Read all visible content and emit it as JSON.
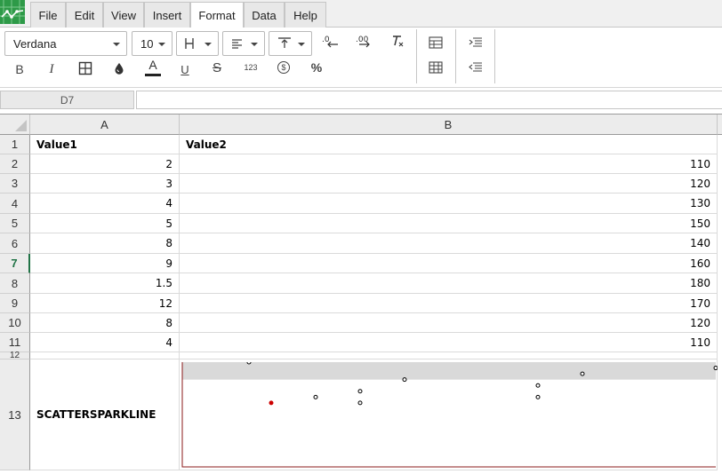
{
  "menu": {
    "items": [
      {
        "id": "file",
        "label": "File"
      },
      {
        "id": "edit",
        "label": "Edit"
      },
      {
        "id": "view",
        "label": "View"
      },
      {
        "id": "insert",
        "label": "Insert"
      },
      {
        "id": "format",
        "label": "Format",
        "active": true
      },
      {
        "id": "data",
        "label": "Data"
      },
      {
        "id": "help",
        "label": "Help"
      }
    ]
  },
  "toolbar": {
    "font_name": "Verdana",
    "font_size": "10",
    "bold_label": "B",
    "italic_label": "I",
    "font_color_label": "A",
    "underline_label": "U",
    "strikethrough_label": "S",
    "number_format_label": "123",
    "currency_label": "$",
    "percent_label": "%",
    "font_color": "#222222"
  },
  "formula_bar": {
    "cell_reference": "D7",
    "formula": ""
  },
  "grid": {
    "columns": [
      "A",
      "B"
    ],
    "rows": [
      {
        "num": "1",
        "a": "Value1",
        "b": "Value2",
        "bold": true
      },
      {
        "num": "2",
        "a": "2",
        "b": "110"
      },
      {
        "num": "3",
        "a": "3",
        "b": "120"
      },
      {
        "num": "4",
        "a": "4",
        "b": "130"
      },
      {
        "num": "5",
        "a": "5",
        "b": "150"
      },
      {
        "num": "6",
        "a": "8",
        "b": "140"
      },
      {
        "num": "7",
        "a": "9",
        "b": "160",
        "active": true
      },
      {
        "num": "8",
        "a": "1.5",
        "b": "180"
      },
      {
        "num": "9",
        "a": "12",
        "b": "170"
      },
      {
        "num": "10",
        "a": "8",
        "b": "120"
      },
      {
        "num": "11",
        "a": "4",
        "b": "110"
      },
      {
        "num": "12",
        "a": "",
        "b": ""
      },
      {
        "num": "13",
        "a": "SCATTERSPARKLINE",
        "b": "",
        "bold": true
      }
    ]
  },
  "chart_data": {
    "type": "scatter",
    "title": "",
    "x": [
      2,
      3,
      4,
      5,
      8,
      9,
      1.5,
      12,
      8,
      4
    ],
    "y": [
      110,
      120,
      130,
      150,
      140,
      160,
      180,
      170,
      120,
      110
    ],
    "xlim": [
      0,
      12
    ],
    "ylim": [
      0,
      180
    ],
    "band": [
      150,
      180
    ],
    "colors": {
      "point": "#000000",
      "highlight_point": "#cc0000",
      "band": "#d9d9d9",
      "axis": "#8b1a1a"
    },
    "highlight_index": 0
  }
}
